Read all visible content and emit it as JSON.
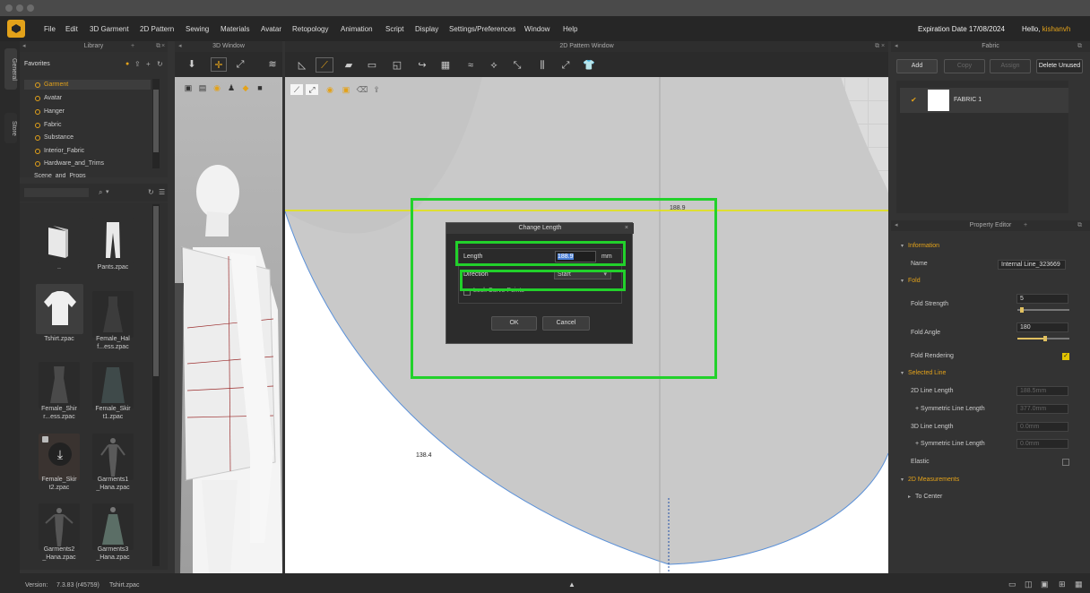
{
  "menubar": {
    "items": [
      "File",
      "Edit",
      "3D Garment",
      "2D Pattern",
      "Sewing",
      "Materials",
      "Avatar",
      "Retopology",
      "Animation",
      "Script",
      "Display",
      "Settings/Preferences",
      "Window",
      "Help"
    ],
    "expiry": "Expiration Date 17/08/2024",
    "hello": "Hello,",
    "username": "kishanvh"
  },
  "sidetabs": {
    "general": "General",
    "store": "Store"
  },
  "library": {
    "title": "Library",
    "favorites": "Favorites",
    "tree": [
      "Garment",
      "Avatar",
      "Hanger",
      "Fabric",
      "Substance",
      "Interior_Fabric",
      "Hardware_and_Trims",
      "Scene_and_Props"
    ],
    "tiles": [
      {
        "label": "..",
        "kind": "folder"
      },
      {
        "label": "Pants.zpac",
        "kind": "pants"
      },
      {
        "label": "Tshirt.zpac",
        "kind": "tshirt"
      },
      {
        "label": "Female_Hal\nf...ess.zpac",
        "kind": "dress"
      },
      {
        "label": "Female_Shir\nr...ess.zpac",
        "kind": "dress2"
      },
      {
        "label": "Female_Skir\nt1.zpac",
        "kind": "skirt"
      },
      {
        "label": "Female_Skir\nt2.zpac",
        "kind": "download"
      },
      {
        "label": "Garments1\n_Hana.zpac",
        "kind": "avatar"
      },
      {
        "label": "Garments2\n_Hana.zpac",
        "kind": "avatar2"
      },
      {
        "label": "Garments3\n_Hana.zpac",
        "kind": "dress3"
      }
    ]
  },
  "window3d": {
    "title": "3D Window"
  },
  "window2d": {
    "title": "2D Pattern Window",
    "measure_top": "188.9",
    "measure_curve": "138.4"
  },
  "dialog": {
    "title": "Change Length",
    "length_label": "Length",
    "length_value": "188.9",
    "length_unit": "mm",
    "direction_label": "Direction",
    "direction_value": "Start",
    "lock_label": "Lock Curve Points",
    "ok": "OK",
    "cancel": "Cancel"
  },
  "fabric": {
    "title": "Fabric",
    "add": "Add",
    "copy": "Copy",
    "assign": "Assign",
    "delete_unused": "Delete Unused",
    "item": "FABRIC 1"
  },
  "property_editor": {
    "title": "Property Editor",
    "information": "Information",
    "name_label": "Name",
    "name_value": "Internal Line_323669",
    "fold": "Fold",
    "fold_strength_label": "Fold Strength",
    "fold_strength_value": "5",
    "fold_strength_level": 0.05,
    "fold_angle_label": "Fold Angle",
    "fold_angle_value": "180",
    "fold_angle_level": 0.5,
    "fold_rendering_label": "Fold Rendering",
    "selected_line": "Selected Line",
    "len2d_label": "2D Line Length",
    "len2d_value": "188.5mm",
    "sym2d_label": "+ Symmetric Line Length",
    "sym2d_value": "377.0mm",
    "len3d_label": "3D Line Length",
    "len3d_value": "0.0mm",
    "sym3d_label": "+ Symmetric Line Length",
    "sym3d_value": "0.0mm",
    "elastic_label": "Elastic",
    "measurements": "2D Measurements",
    "to_center": "To Center"
  },
  "status": {
    "version_label": "Version:",
    "version_value": "7.3.83 (r45759)",
    "file": "Tshirt.zpac"
  },
  "colors": {
    "accent": "#e3a21a",
    "highlight": "#22d12b",
    "measure_line": "#e6e600"
  }
}
